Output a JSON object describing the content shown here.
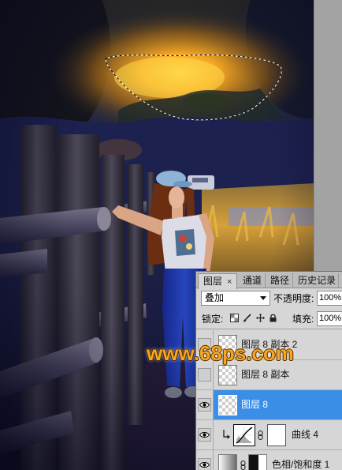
{
  "watermark": {
    "text": "www.68ps.com",
    "color": "#f5a623"
  },
  "canvas": {
    "pasteboard_color": "#a3a3a3"
  },
  "layers_panel": {
    "tabs": [
      {
        "label": "图层",
        "close": "×",
        "active": true
      },
      {
        "label": "通道",
        "active": false
      },
      {
        "label": "路径",
        "active": false
      },
      {
        "label": "历史记录",
        "active": false
      }
    ],
    "blend_mode": {
      "value": "叠加",
      "icon": "dropdown-arrow-icon"
    },
    "opacity": {
      "label": "不透明度:",
      "value": "100%"
    },
    "lock": {
      "label": "锁定:",
      "icons": [
        "lock-transparency-icon",
        "lock-paint-icon",
        "lock-position-icon",
        "lock-all-icon"
      ]
    },
    "fill": {
      "label": "填充:",
      "value": "100%"
    },
    "layers": [
      {
        "name": "图层 8 副本 2",
        "visible": false,
        "selected": false,
        "thumbnail": "transparent-thumbnail"
      },
      {
        "name": "图层 8 副本",
        "visible": false,
        "selected": false,
        "thumbnail": "transparent-thumbnail"
      },
      {
        "name": "图层 8",
        "visible": true,
        "selected": true,
        "thumbnail": "transparent-thumbnail"
      },
      {
        "name": "曲线 4",
        "visible": true,
        "selected": false,
        "clipped": true,
        "thumbnail": "curves-adjustment-icon",
        "mask": "white-mask-thumbnail"
      },
      {
        "name": "色相/饱和度 1",
        "visible": true,
        "selected": false,
        "thumbnail": "hue-saturation-thumbnail",
        "mask": "mask-thumbnail"
      }
    ],
    "colors": {
      "panel": "#d6d6d6",
      "tab_bar": "#bdbdbd",
      "selected_row": "#3a8ee6"
    }
  }
}
